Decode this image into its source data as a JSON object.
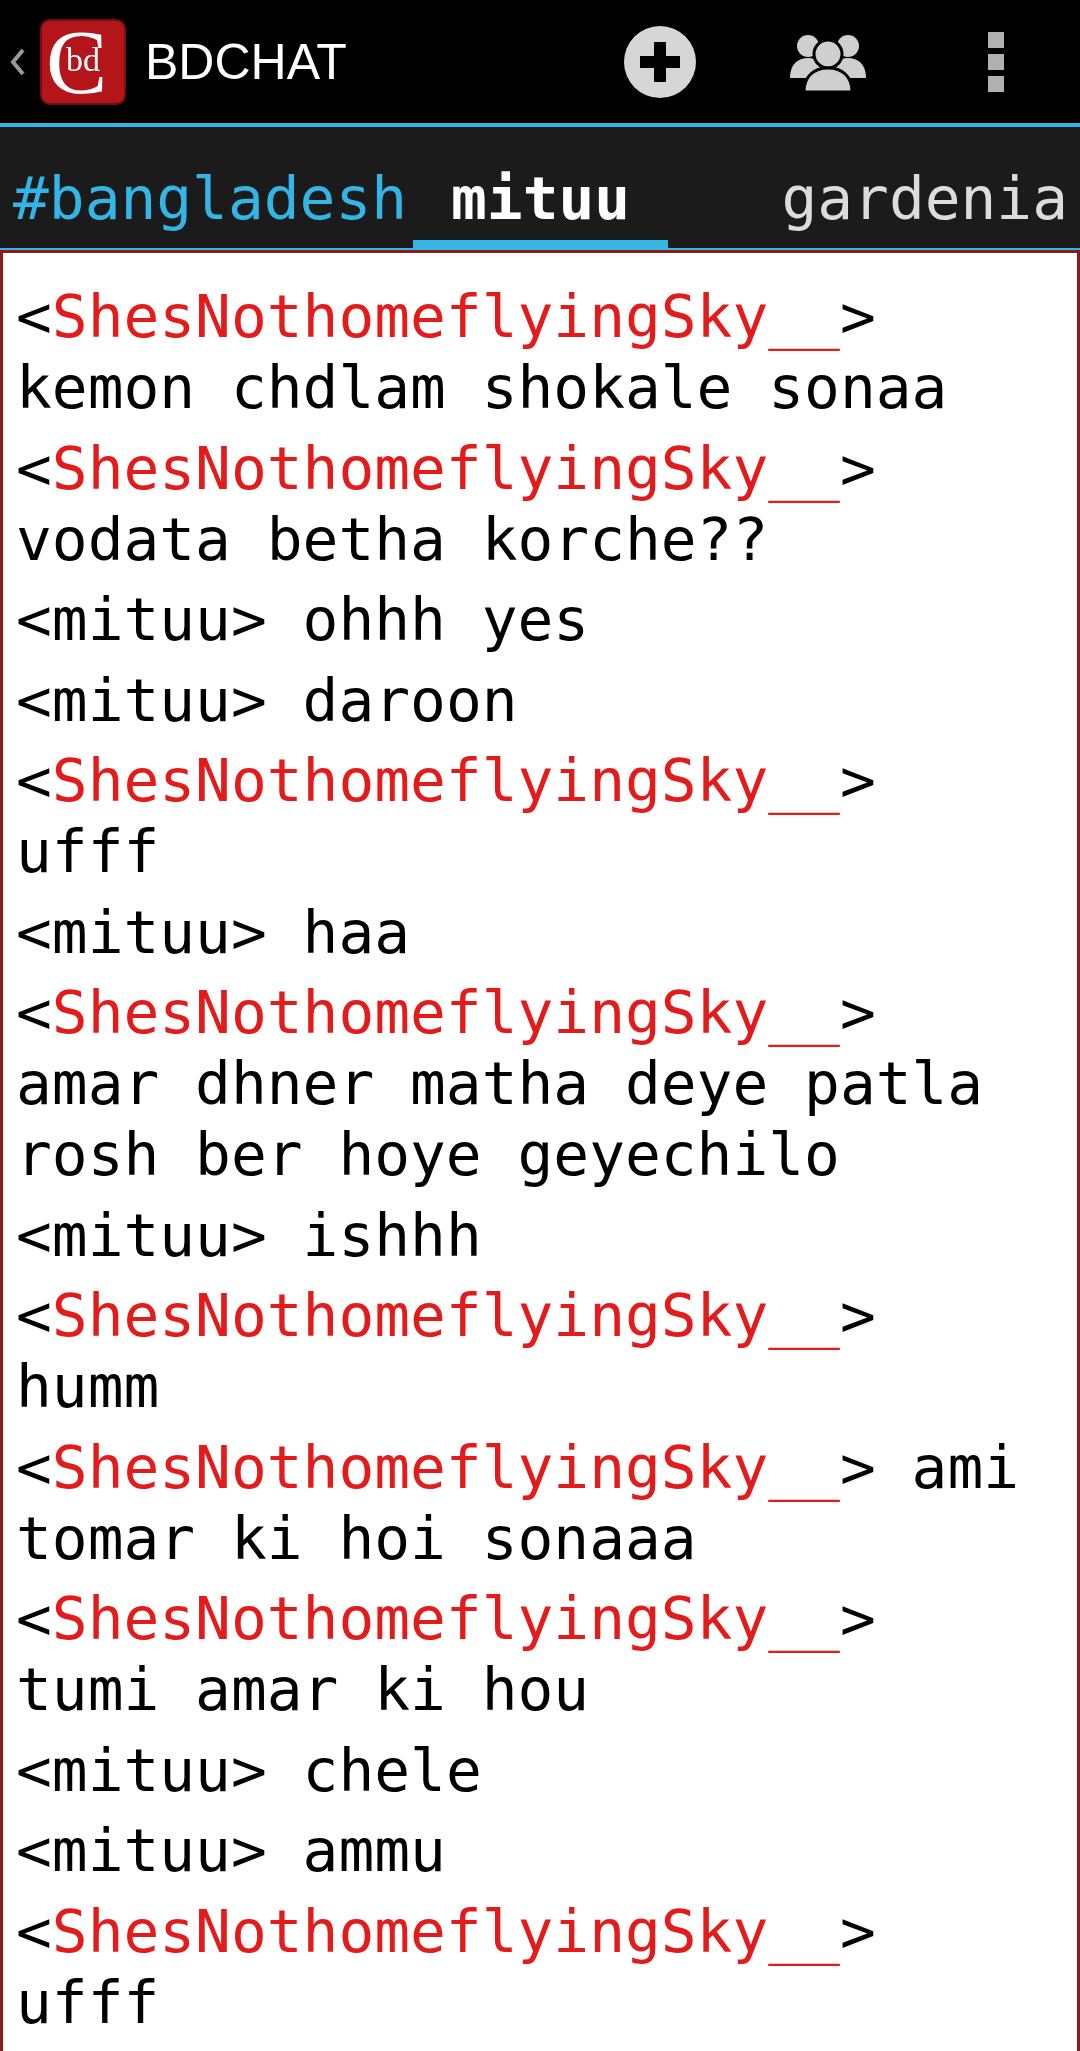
{
  "app_bar": {
    "logo": {
      "initial": "C",
      "letters": "bd"
    },
    "title": "BDCHAT"
  },
  "tabs": [
    {
      "label": "#bangladesh",
      "selected": false,
      "color": "#33b5e5"
    },
    {
      "label": "mituu",
      "selected": true,
      "color": "#ffffff"
    },
    {
      "label": "gardenia",
      "selected": false,
      "color": "#dcdcdc"
    }
  ],
  "messages": [
    {
      "open": "<",
      "nick": "ShesNothomeflyingSky__",
      "close": ">",
      "text": "kemon chdlam shokale sonaa",
      "color": "#e31b1b"
    },
    {
      "open": "<",
      "nick": "ShesNothomeflyingSky__",
      "close": ">",
      "text": "vodata betha korche??",
      "color": "#e31b1b"
    },
    {
      "open": "<",
      "nick": "mituu",
      "close": ">",
      "text": "ohhh yes",
      "color": "#000000"
    },
    {
      "open": "<",
      "nick": "mituu",
      "close": ">",
      "text": "daroon",
      "color": "#000000"
    },
    {
      "open": "<",
      "nick": "ShesNothomeflyingSky__",
      "close": ">",
      "text": "ufff",
      "color": "#e31b1b"
    },
    {
      "open": "<",
      "nick": "mituu",
      "close": ">",
      "text": "haa",
      "color": "#000000"
    },
    {
      "open": "<",
      "nick": "ShesNothomeflyingSky__",
      "close": ">",
      "text": "amar dhner matha deye patla rosh ber hoye geyechilo",
      "color": "#e31b1b"
    },
    {
      "open": "<",
      "nick": "mituu",
      "close": ">",
      "text": "ishhh",
      "color": "#000000"
    },
    {
      "open": "<",
      "nick": "ShesNothomeflyingSky__",
      "close": ">",
      "text": "humm",
      "color": "#e31b1b"
    },
    {
      "open": "<",
      "nick": "ShesNothomeflyingSky__",
      "close": ">",
      "text": "ami tomar ki hoi sonaaa",
      "color": "#e31b1b"
    },
    {
      "open": "<",
      "nick": "ShesNothomeflyingSky__",
      "close": ">",
      "text": "tumi amar ki hou",
      "color": "#e31b1b"
    },
    {
      "open": "<",
      "nick": "mituu",
      "close": ">",
      "text": "chele",
      "color": "#000000"
    },
    {
      "open": "<",
      "nick": "mituu",
      "close": ">",
      "text": "ammu",
      "color": "#000000"
    },
    {
      "open": "<",
      "nick": "ShesNothomeflyingSky__",
      "close": ">",
      "text": "ufff",
      "color": "#e31b1b"
    }
  ]
}
